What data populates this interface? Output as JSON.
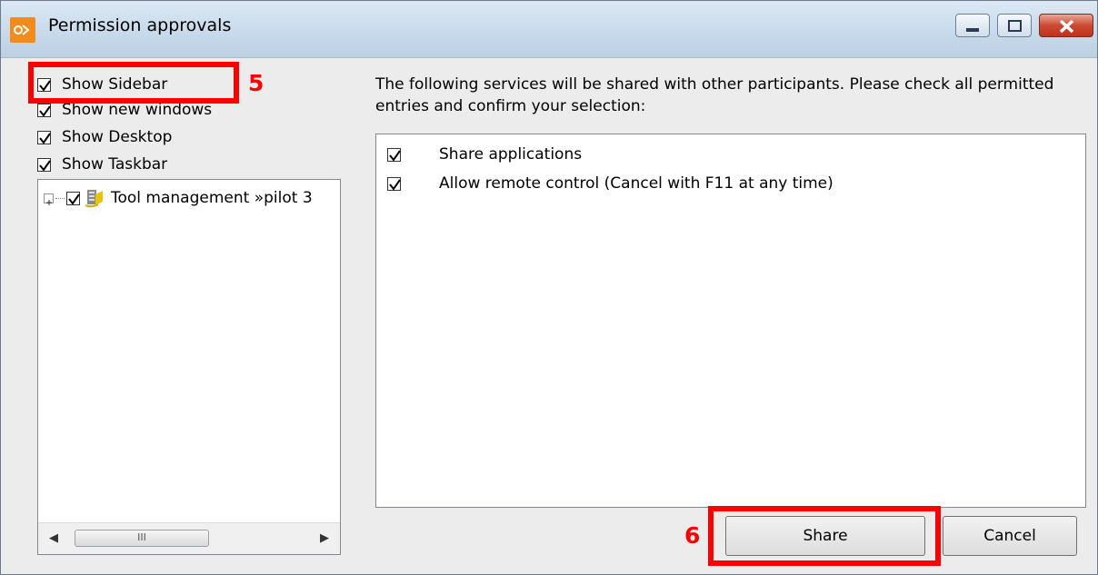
{
  "window": {
    "title": "Permission approvals",
    "controls": [
      "minimize",
      "maximize",
      "close"
    ]
  },
  "left": {
    "options": [
      {
        "label": "Show Sidebar",
        "checked": true
      },
      {
        "label": "Show new windows",
        "checked": true
      },
      {
        "label": "Show Desktop",
        "checked": true
      },
      {
        "label": "Show Taskbar",
        "checked": true
      }
    ],
    "tree": {
      "items": [
        {
          "label": "Tool management »pilot 3",
          "checked": true,
          "icon": "tool-management-icon"
        }
      ],
      "scroll_thumb_glyph": "III"
    }
  },
  "main": {
    "intro": "The following services will be shared with other participants. Please check all permitted entries and confirm your selection:",
    "services": [
      {
        "label": "Share applications",
        "checked": true
      },
      {
        "label": "Allow remote control (Cancel with F11 at any time)",
        "checked": true
      }
    ]
  },
  "buttons": {
    "share": "Share",
    "cancel": "Cancel"
  },
  "annotations": {
    "marker_5": "5",
    "marker_6": "6",
    "color": "#ff0000"
  }
}
